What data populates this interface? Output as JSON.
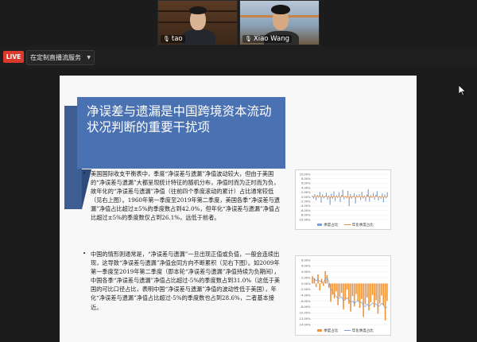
{
  "participants": [
    {
      "name": "tao"
    },
    {
      "name": "Xiao Wang"
    }
  ],
  "live": {
    "badge": "LIVE",
    "service_label": "在定制直播流服务"
  },
  "slide": {
    "title": "净误差与遗漏是中国跨境资本流动状况判断的重要干扰项",
    "bullets": [
      "美国国际收支平衡表中，季度“净误差与遗漏”净值波动较大，但由于美国的“净误差与遗漏”大都呈现统计特征的随机分布，净值时而为正时而为负，故年化的“净误差与遗漏”净值（往前四个季度滚动的累计）占比通常较低（见右上图）。1960年第一季度至2019年第二季度，美国各季“净误差与遗漏”净值占比超过±5%的季度数占到42.0%，但年化“净误差与遗漏”净值占比超过±5%的季度数仅占到26.1%，远低于前者。",
      "中国的情形则通常是，“净误差与遗漏”一旦出现正值或负值，一般会连续出现，这导致“净误差与遗漏”净值会同方向不断累积（见右下图）。如2009年第一季度至2019年第二季度（即本轮“净误差与遗漏”净值持续为负期间），中国各季“净误差与遗漏”净值占比超过-5%的季度数占到31.0%（这低于美国的可比口径占比，表明中国“净误差与遗漏”净值的波动性低于美国），年化“净误差与遗漏”净值占比超过-5%的季度数也占到28.6%，二者基本接近。"
    ]
  },
  "charts": [
    {
      "type": "bar",
      "ylim": [
        -10,
        10
      ],
      "ytick_labels": [
        "10.00%",
        "8.00%",
        "6.00%",
        "4.00%",
        "2.00%",
        "0.00%",
        "-2.00%",
        "-4.00%",
        "-6.00%",
        "-8.00%",
        "-10.00%"
      ],
      "legend": [
        "季度占比",
        "年化季度占比"
      ],
      "colors": {
        "bar": "#7a9fd0",
        "line": "#f29233"
      },
      "values": [
        0.5,
        -0.8,
        1.2,
        -1.5,
        0.9,
        -0.4,
        2.1,
        -2.6,
        1.1,
        -0.7,
        0.3,
        1.8,
        -1.2,
        0.6,
        -3.5,
        1.4,
        -0.9,
        2.4,
        -1.8,
        0.7,
        -0.5,
        1.9,
        -2.2,
        0.8,
        3.1,
        -1.1,
        0.4,
        -0.6,
        2.7,
        -4.1,
        1.3,
        -0.8,
        0.5,
        1.6,
        -2.9,
        0.9,
        -0.3,
        1.2,
        -1.4,
        2.2,
        -0.7,
        0.6,
        -1.9,
        1.1,
        3.4,
        -2.1,
        0.8,
        -0.5,
        1.7,
        -1.3,
        0.9,
        2.5,
        -1.6,
        0.4,
        -0.9,
        1.5,
        -2.4,
        1.0,
        -0.6,
        2.0
      ],
      "line": [
        0.3,
        0.1,
        0.4,
        -0.2,
        0.2,
        0.1,
        0.6,
        -0.3,
        0.2,
        0.1,
        0.0,
        0.5,
        -0.1,
        0.2,
        -0.8,
        0.1,
        -0.1,
        0.5,
        -0.3,
        0.1,
        -0.1,
        0.4,
        -0.4,
        0.2,
        0.7,
        -0.2,
        0.1,
        -0.1,
        0.5,
        -0.9,
        0.2,
        -0.1,
        0.1,
        0.3,
        -0.6,
        0.2,
        0.0,
        0.3,
        -0.2,
        0.5,
        -0.1,
        0.1,
        -0.4,
        0.2,
        0.8,
        -0.4,
        0.1,
        -0.1,
        0.3,
        -0.2,
        0.2,
        0.5,
        -0.3,
        0.1,
        -0.2,
        0.3,
        -0.5,
        0.2,
        -0.1,
        0.4
      ]
    },
    {
      "type": "bar",
      "ylim": [
        -14,
        8
      ],
      "ytick_labels": [
        "8.00%",
        "6.00%",
        "4.00%",
        "2.00%",
        "0.00%",
        "-2.00%",
        "-4.00%",
        "-6.00%",
        "-8.00%",
        "-10.00%",
        "-12.00%",
        "-14.00%"
      ],
      "legend": [
        "季度占比",
        "年化季度占比"
      ],
      "colors": {
        "bar": "#f29233",
        "line": "#7a9fd0"
      },
      "values": [
        2.5,
        1.8,
        -1.2,
        3.1,
        -2.4,
        1.6,
        -0.8,
        4.2,
        2.9,
        -1.5,
        -6.2,
        -3.8,
        -5.1,
        -2.7,
        -7.4,
        -4.6,
        -3.2,
        -8.8,
        -5.5,
        -2.1,
        -6.9,
        -9.6,
        -4.3,
        -7.8,
        -3.6,
        -6.1,
        -8.3,
        -5.2,
        -11.4,
        -7.1,
        -4.8,
        -9.2,
        -6.4,
        -3.9,
        -8.1,
        -5.7,
        -10.3,
        -6.8,
        -4.1,
        -7.5,
        -12.6,
        -5.9
      ],
      "line": [
        1.8,
        1.6,
        0.9,
        1.5,
        0.7,
        0.8,
        0.2,
        1.7,
        2.1,
        0.6,
        -1.8,
        -2.6,
        -3.9,
        -4.4,
        -5.2,
        -5.0,
        -4.6,
        -5.9,
        -5.6,
        -4.8,
        -5.7,
        -6.4,
        -6.0,
        -6.9,
        -6.2,
        -5.9,
        -6.6,
        -6.3,
        -7.6,
        -7.9,
        -7.0,
        -7.8,
        -7.4,
        -6.6,
        -7.2,
        -6.9,
        -7.8,
        -7.6,
        -6.7,
        -7.3,
        -8.6,
        -7.9
      ]
    }
  ]
}
